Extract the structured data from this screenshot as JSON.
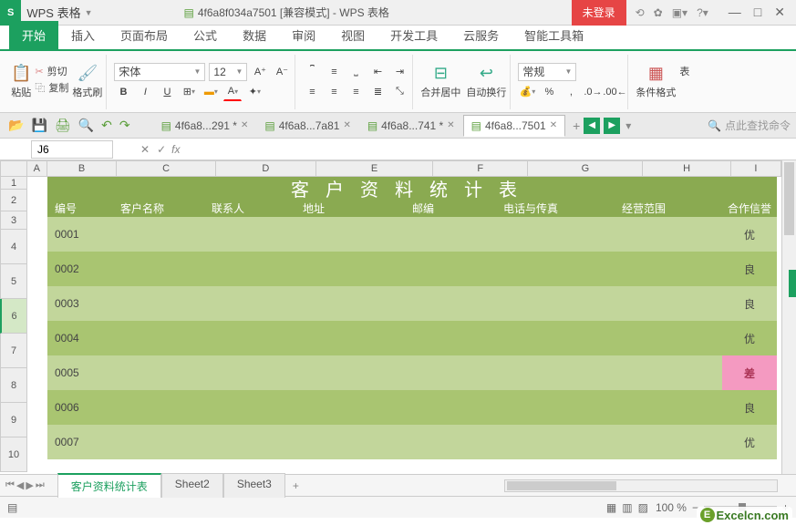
{
  "app": {
    "badge": "S",
    "name": "WPS 表格",
    "docTitle": "4f6a8f034a7501 [兼容模式] - WPS 表格",
    "login": "未登录"
  },
  "menu": {
    "start": "开始",
    "insert": "插入",
    "layout": "页面布局",
    "formula": "公式",
    "data": "数据",
    "review": "审阅",
    "view": "视图",
    "dev": "开发工具",
    "cloud": "云服务",
    "smart": "智能工具箱"
  },
  "ribbon": {
    "paste": "粘贴",
    "cut": "剪切",
    "copy": "复制",
    "formatPainter": "格式刷",
    "font": "宋体",
    "fontSize": "12",
    "mergeCenter": "合并居中",
    "autoWrap": "自动换行",
    "numberFormat": "常规",
    "condFormat": "条件格式",
    "table": "表"
  },
  "qat": {
    "tabs": [
      {
        "label": "4f6a8...291 *"
      },
      {
        "label": "4f6a8...7a81"
      },
      {
        "label": "4f6a8...741 *"
      },
      {
        "label": "4f6a8...7501"
      }
    ],
    "searchPlaceholder": "点此查找命令"
  },
  "formula": {
    "cellRef": "J6",
    "fx": "fx"
  },
  "cols": [
    {
      "l": "A",
      "w": 22
    },
    {
      "l": "B",
      "w": 78
    },
    {
      "l": "C",
      "w": 110
    },
    {
      "l": "D",
      "w": 112
    },
    {
      "l": "E",
      "w": 130
    },
    {
      "l": "F",
      "w": 106
    },
    {
      "l": "G",
      "w": 128
    },
    {
      "l": "H",
      "w": 98
    },
    {
      "l": "I",
      "w": 56
    }
  ],
  "rows": [
    {
      "n": "1",
      "h": 14
    },
    {
      "n": "2",
      "h": 24
    },
    {
      "n": "3",
      "h": 20
    },
    {
      "n": "4",
      "h": 38
    },
    {
      "n": "5",
      "h": 38
    },
    {
      "n": "6",
      "h": 38,
      "sel": true
    },
    {
      "n": "7",
      "h": 38
    },
    {
      "n": "8",
      "h": 38
    },
    {
      "n": "9",
      "h": 38
    },
    {
      "n": "10",
      "h": 38
    }
  ],
  "sheet": {
    "title": "客户资料统计表",
    "headers": {
      "num": "编号",
      "name": "客户名称",
      "contact": "联系人",
      "addr": "地址",
      "zip": "邮编",
      "phone": "电话与传真",
      "scope": "经营范围",
      "credit": "合作信誉"
    },
    "data": [
      {
        "num": "0001",
        "credit": "优"
      },
      {
        "num": "0002",
        "credit": "良"
      },
      {
        "num": "0003",
        "credit": "良"
      },
      {
        "num": "0004",
        "credit": "优"
      },
      {
        "num": "0005",
        "credit": "差",
        "bad": true
      },
      {
        "num": "0006",
        "credit": "良"
      },
      {
        "num": "0007",
        "credit": "优"
      }
    ]
  },
  "sheetTabs": {
    "active": "客户资料统计表",
    "s2": "Sheet2",
    "s3": "Sheet3"
  },
  "status": {
    "zoom": "100 %"
  },
  "watermark": "Excelcn.com"
}
